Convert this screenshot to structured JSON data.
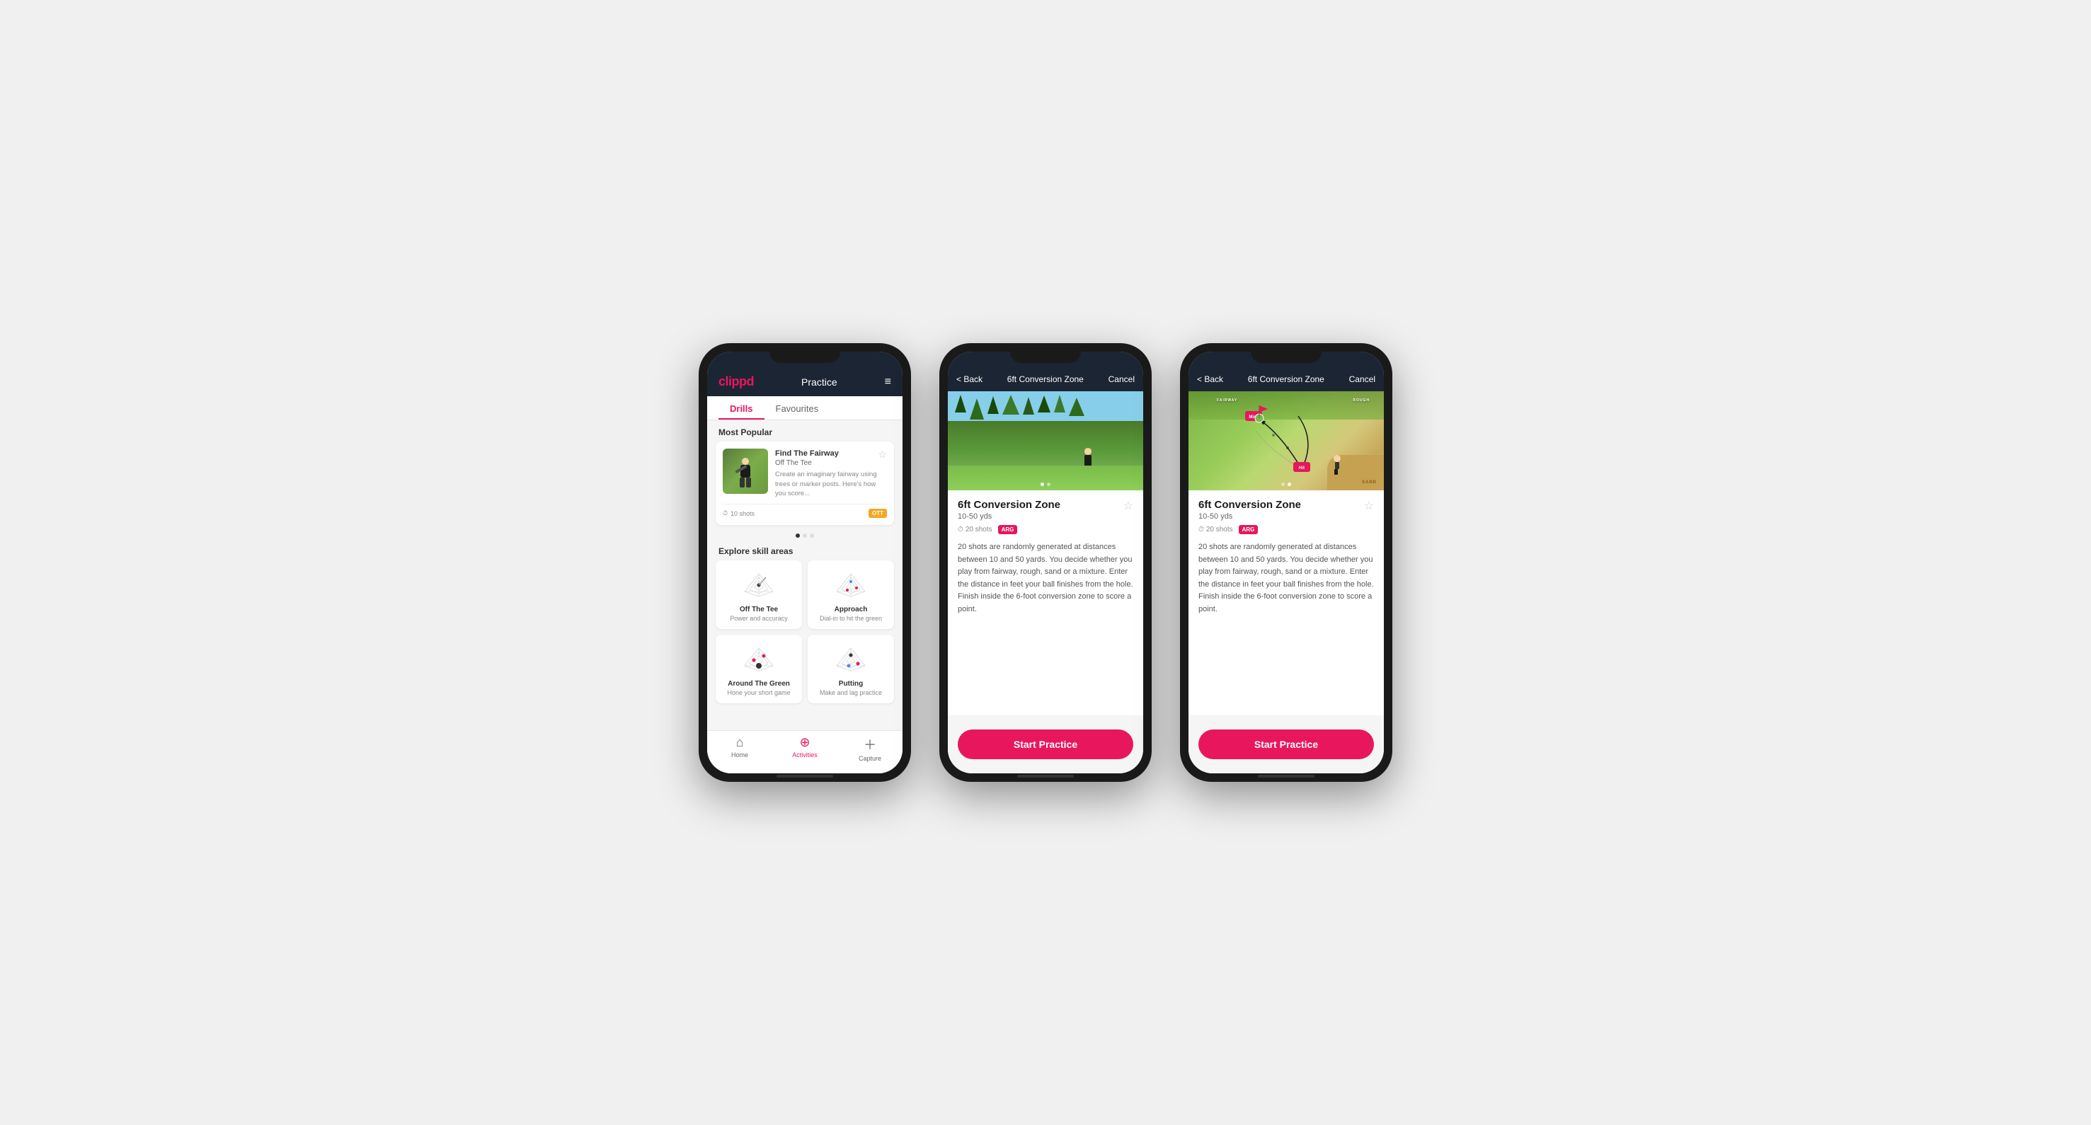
{
  "phone1": {
    "header": {
      "logo": "clippd",
      "title": "Practice",
      "menu_icon": "≡"
    },
    "tabs": [
      {
        "label": "Drills",
        "active": true
      },
      {
        "label": "Favourites",
        "active": false
      }
    ],
    "most_popular_label": "Most Popular",
    "drill_card": {
      "title": "Find The Fairway",
      "subtitle": "Off The Tee",
      "description": "Create an imaginary fairway using trees or marker posts. Here's how you score...",
      "shots": "10 shots",
      "badge": "OTT",
      "fav_icon": "☆"
    },
    "explore_label": "Explore skill areas",
    "skill_areas": [
      {
        "name": "Off The Tee",
        "desc": "Power and accuracy"
      },
      {
        "name": "Approach",
        "desc": "Dial-in to hit the green"
      },
      {
        "name": "Around The Green",
        "desc": "Hone your short game"
      },
      {
        "name": "Putting",
        "desc": "Make and lag practice"
      }
    ],
    "bottom_nav": [
      {
        "label": "Home",
        "icon": "⌂",
        "active": false
      },
      {
        "label": "Activities",
        "icon": "⊕",
        "active": true
      },
      {
        "label": "Capture",
        "icon": "+",
        "active": false
      }
    ]
  },
  "phone2": {
    "header": {
      "back": "< Back",
      "title": "6ft Conversion Zone",
      "cancel": "Cancel"
    },
    "drill": {
      "name": "6ft Conversion Zone",
      "range": "10-50 yds",
      "shots": "20 shots",
      "badge": "ARG",
      "fav_icon": "☆",
      "description": "20 shots are randomly generated at distances between 10 and 50 yards. You decide whether you play from fairway, rough, sand or a mixture. Enter the distance in feet your ball finishes from the hole. Finish inside the 6-foot conversion zone to score a point.",
      "start_btn": "Start Practice"
    }
  },
  "phone3": {
    "header": {
      "back": "< Back",
      "title": "6ft Conversion Zone",
      "cancel": "Cancel"
    },
    "drill": {
      "name": "6ft Conversion Zone",
      "range": "10-50 yds",
      "shots": "20 shots",
      "badge": "ARG",
      "fav_icon": "☆",
      "description": "20 shots are randomly generated at distances between 10 and 50 yards. You decide whether you play from fairway, rough, sand or a mixture. Enter the distance in feet your ball finishes from the hole. Finish inside the 6-foot conversion zone to score a point.",
      "start_btn": "Start Practice"
    }
  },
  "icons": {
    "clock": "⏱",
    "heart": "♥",
    "star": "★",
    "home": "⌂",
    "plus": "＋",
    "activity": "⊕",
    "back_arrow": "‹",
    "check": "✓"
  }
}
